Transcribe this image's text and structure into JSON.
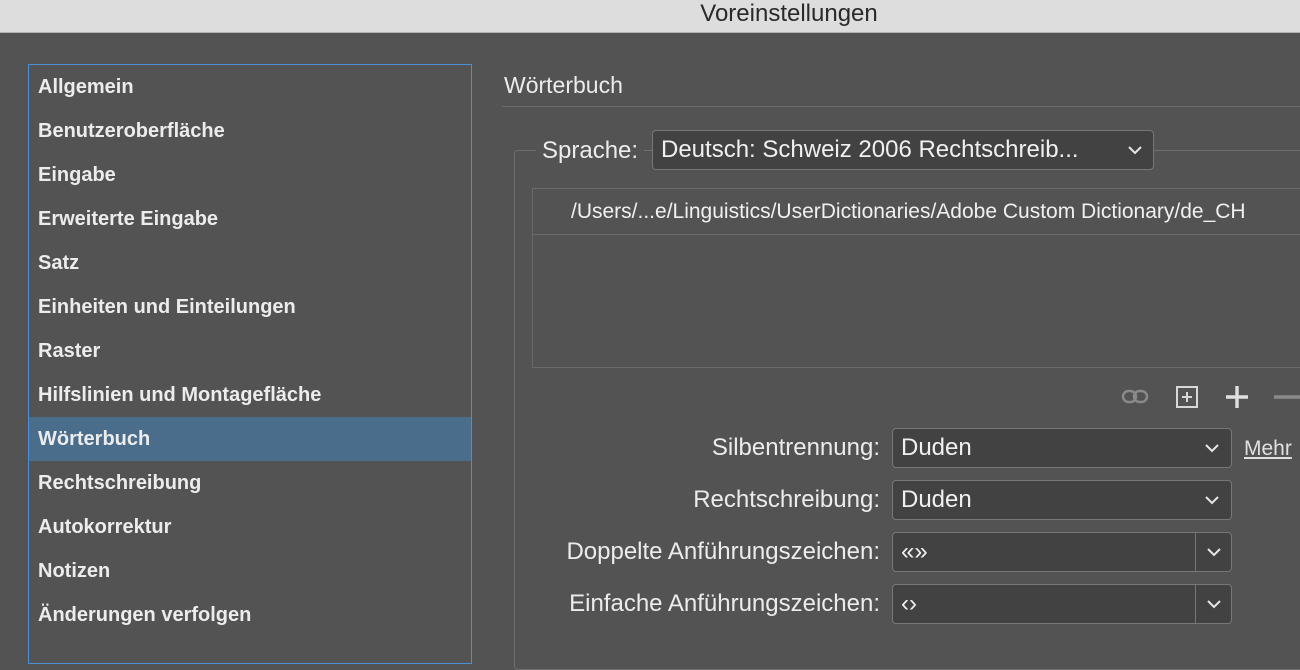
{
  "window": {
    "title": "Voreinstellungen"
  },
  "sidebar": {
    "items": [
      {
        "label": "Allgemein"
      },
      {
        "label": "Benutzeroberfläche"
      },
      {
        "label": "Eingabe"
      },
      {
        "label": "Erweiterte Eingabe"
      },
      {
        "label": "Satz"
      },
      {
        "label": "Einheiten und Einteilungen"
      },
      {
        "label": "Raster"
      },
      {
        "label": "Hilfslinien und Montagefläche"
      },
      {
        "label": "Wörterbuch"
      },
      {
        "label": "Rechtschreibung"
      },
      {
        "label": "Autokorrektur"
      },
      {
        "label": "Notizen"
      },
      {
        "label": "Änderungen verfolgen"
      }
    ],
    "selected": "Wörterbuch"
  },
  "main": {
    "section_title": "Wörterbuch",
    "language": {
      "label": "Sprache:",
      "value": "Deutsch: Schweiz 2006 Rechtschreib..."
    },
    "dictionary_list": {
      "rows": [
        {
          "path": "/Users/...e/Linguistics/UserDictionaries/Adobe Custom Dictionary/de_CH"
        }
      ]
    },
    "toolbar": {
      "icons": [
        "link-icon",
        "new-dictionary-icon",
        "add-icon",
        "remove-icon"
      ]
    },
    "hyphenation": {
      "label": "Silbentrennung:",
      "value": "Duden",
      "more_link": "Mehr"
    },
    "spelling": {
      "label": "Rechtschreibung:",
      "value": "Duden"
    },
    "double_quotes": {
      "label": "Doppelte Anführungszeichen:",
      "value": "«»"
    },
    "single_quotes": {
      "label": "Einfache Anführungszeichen:",
      "value": "‹›"
    }
  },
  "colors": {
    "panel_bg": "#535353",
    "selection": "#4a6d8c",
    "focus_border": "#4a90d9",
    "titlebar": "#dddddd"
  }
}
